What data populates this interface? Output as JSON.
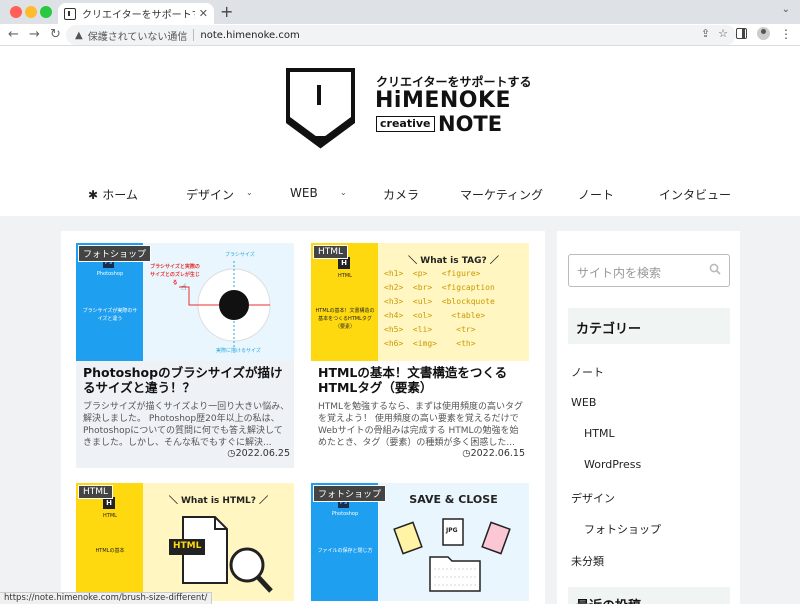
{
  "browser": {
    "tab_title": "クリエイターをサポートする｜創",
    "tab_close": "✕",
    "new_tab": "+",
    "security_text": "保護されていない通信",
    "url": "note.himenoke.com"
  },
  "site": {
    "tagline": "クリエイターをサポートする",
    "name": "HiMENOKE",
    "sub": "creative",
    "note": "NOTE"
  },
  "nav": {
    "items": [
      {
        "label": "ホーム",
        "has_dropdown": false
      },
      {
        "label": "デザイン",
        "has_dropdown": true
      },
      {
        "label": "WEB",
        "has_dropdown": true
      },
      {
        "label": "カメラ",
        "has_dropdown": false
      },
      {
        "label": "マーケティング",
        "has_dropdown": false
      },
      {
        "label": "ノート",
        "has_dropdown": false
      },
      {
        "label": "インタビュー",
        "has_dropdown": false
      }
    ]
  },
  "posts": [
    {
      "category": "フォトショップ",
      "title": "Photoshopのブラシサイズが描けるサイズと違う！？",
      "excerpt": "ブラシサイズが描くサイズより一回り大きい悩み、解決しました。 Photoshop歴20年以上の私は、Photoshopについての質問に何でも答え解決してきました。しかし、そんな私でもすぐに解決...",
      "date": "2022.06.25",
      "thumb": {
        "mini_icon": "Ps",
        "mini_label": "Photoshop",
        "mini_text": "ブラシサイズが実際のサイズと違う",
        "label_top": "ブラシサイズ",
        "label_red": "ブラシサイズと実際のサイズとのズレが生じる",
        "label_bottom": "実際に描けるサイズ"
      }
    },
    {
      "category": "HTML",
      "title": "HTMLの基本！文書構造をつくるHTMLタグ（要素）",
      "excerpt": "HTMLを勉強するなら、まずは使用頻度の高いタグを覚えよう！ 使用頻度の高い要素を覚えるだけでWebサイトの骨組みは完成する HTMLの勉強を始めたとき、タグ（要素）の種類が多く困惑した...",
      "date": "2022.06.15",
      "thumb": {
        "mini_icon": "H",
        "mini_label": "HTML",
        "mini_text": "HTMLの基本！文書構造の基本をつくるHTMLタグ（要素）",
        "heading": "＼ What is TAG? ／",
        "tags": "<h1>  <p>   <figure>\n<h2>  <br>  <figcaption\n<h3>  <ul>  <blockquote\n<h4>  <ol>    <table>\n<h5>  <li>     <tr>\n<h6>  <img>    <th>"
      }
    },
    {
      "category": "HTML",
      "thumb": {
        "mini_icon": "H",
        "mini_label": "HTML",
        "mini_text": "HTMLの基本",
        "heading": "＼ What is HTML? ／",
        "file_label": "HTML"
      }
    },
    {
      "category": "フォトショップ",
      "thumb": {
        "mini_icon": "Ps",
        "mini_label": "Photoshop",
        "mini_text": "ファイルの保存と閉じ方",
        "heading": "SAVE & CLOSE",
        "file_label": "JPG"
      }
    }
  ],
  "sidebar": {
    "search_placeholder": "サイト内を検索",
    "category_heading": "カテゴリー",
    "categories": [
      {
        "label": "ノート"
      },
      {
        "label": "WEB"
      },
      {
        "label": "HTML"
      },
      {
        "label": "WordPress"
      },
      {
        "label": "デザイン"
      },
      {
        "label": "フォトショップ"
      },
      {
        "label": "未分類"
      }
    ],
    "recent_heading": "最近の投稿"
  },
  "status_url": "https://note.himenoke.com/brush-size-different/"
}
